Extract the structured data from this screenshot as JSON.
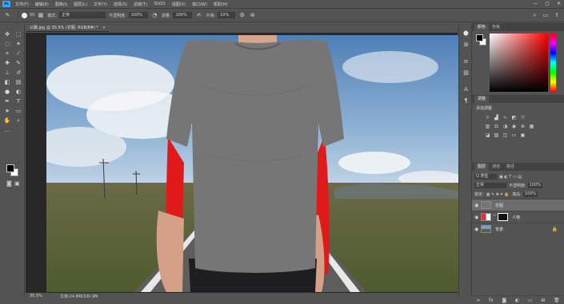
{
  "menubar": {
    "logo": "Ps",
    "items": [
      "文件(F)",
      "编辑(E)",
      "图像(I)",
      "图层(L)",
      "文字(Y)",
      "选择(S)",
      "滤镜(T)",
      "3D(D)",
      "视图(V)",
      "窗口(W)",
      "帮助(H)"
    ],
    "controls": [
      "—",
      "▢",
      "✕"
    ]
  },
  "options": {
    "brush_size": "50",
    "mode_label": "模式:",
    "mode_value": "正常",
    "opacity_label": "不透明度:",
    "opacity_value": "100%",
    "flow_label": "流量:",
    "flow_value": "100%",
    "smooth_label": "平滑:",
    "smooth_value": "10%"
  },
  "document": {
    "tab_title": "公路.jpg @ 30.5% (衣服, RGB/8#) *",
    "zoom": "30.5%",
    "doc_info": "文档:24.8M/100.9M"
  },
  "panels": {
    "color_tabs": [
      "颜色",
      "色板"
    ],
    "adjust_tab": "调整",
    "adjust_title": "添加调整",
    "layer_tabs": [
      "图层",
      "通道",
      "路径"
    ],
    "kind_label": "Q 类型",
    "blend_mode": "正常",
    "opacity_label": "不透明度:",
    "opacity_value": "100%",
    "lock_label": "锁定:",
    "fill_label": "填充:",
    "fill_value": "100%",
    "layers": [
      {
        "name": "衣服"
      },
      {
        "name": "人物"
      },
      {
        "name": "背景"
      }
    ]
  },
  "colors": {
    "accent": "#31a8ff",
    "ui_bg": "#535353",
    "canvas_bg": "#282828",
    "highlight_red": "#e01a1a",
    "shirt": "#767676"
  }
}
